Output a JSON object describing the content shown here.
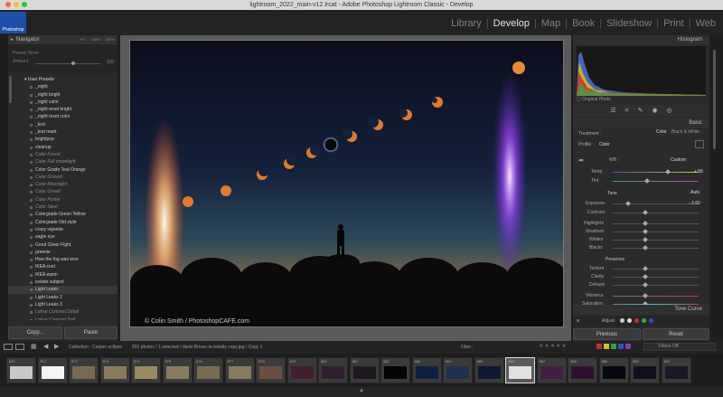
{
  "window": {
    "title": "lightroom_2022_main-v12.lrcat - Adobe Photoshop Lightroom Classic - Develop"
  },
  "logo": {
    "text": "Photoshop"
  },
  "modules": [
    "Library",
    "Develop",
    "Map",
    "Book",
    "Slideshow",
    "Print",
    "Web"
  ],
  "active_module": "Develop",
  "left_panel": {
    "navigator_title": "Navigator",
    "nav_sizes": [
      "FIT",
      "100%",
      "200%"
    ],
    "preset_label": "Preset: None",
    "amount_label": "Amount",
    "amount_value": "100",
    "presets_folder": "User Presets",
    "presets": [
      {
        "label": "_night",
        "italic": false
      },
      {
        "label": "_night bright",
        "italic": false
      },
      {
        "label": "_night color",
        "italic": false
      },
      {
        "label": "_night reset bright",
        "italic": false
      },
      {
        "label": "_night reset color",
        "italic": false
      },
      {
        "label": "_test",
        "italic": false
      },
      {
        "label": "_test reset",
        "italic": false
      },
      {
        "label": "brightpop",
        "italic": false
      },
      {
        "label": "cleanup",
        "italic": false
      },
      {
        "label": "Color Forest",
        "italic": true
      },
      {
        "label": "Color Full moonlight",
        "italic": true
      },
      {
        "label": "Color Grade Teal Orange",
        "italic": false
      },
      {
        "label": "Color Ground",
        "italic": true
      },
      {
        "label": "Color Moonlight",
        "italic": true
      },
      {
        "label": "Color Orwell",
        "italic": true
      },
      {
        "label": "Color Poster",
        "italic": true
      },
      {
        "label": "Color Steel",
        "italic": true
      },
      {
        "label": "Colorgrade Green Yellow",
        "italic": false
      },
      {
        "label": "Colorgrade Old style",
        "italic": false
      },
      {
        "label": "crazy vignette",
        "italic": false
      },
      {
        "label": "eagle eye",
        "italic": false
      },
      {
        "label": "Good Clean Fight",
        "italic": false
      },
      {
        "label": "greenie",
        "italic": false
      },
      {
        "label": "How the fog was won",
        "italic": false
      },
      {
        "label": "IKEA cool",
        "italic": false
      },
      {
        "label": "IKEA warm",
        "italic": false
      },
      {
        "label": "isolate subject",
        "italic": false
      },
      {
        "label": "Light Leaks",
        "italic": false
      },
      {
        "label": "Light Leaks 2",
        "italic": false
      },
      {
        "label": "Light Leaks 3",
        "italic": false
      },
      {
        "label": "Lohse Contrast Detail",
        "italic": true
      },
      {
        "label": "Lohse Contrast Soft",
        "italic": true
      }
    ],
    "copy_button": "Copy...",
    "paste_button": "Paste"
  },
  "photo": {
    "watermark": "© Colin Smith / PhotoshopCAFE.com"
  },
  "right_panel": {
    "histogram_title": "Histogram",
    "original_photo": "Original Photo",
    "basic_title": "Basic",
    "treatment_label": "Treatment :",
    "treatment_options": [
      "Color",
      "Black & White"
    ],
    "profile_label": "Profile :",
    "profile_value": "Color",
    "wb_label": "WB :",
    "wb_value": "Custom",
    "temp_label": "Temp",
    "temp_value": "+ 56",
    "tint_label": "Tint",
    "tint_value": "",
    "tone_label": "Tone",
    "auto_label": "Auto",
    "exposure_label": "Exposure",
    "exposure_value": "- 2.60",
    "contrast_label": "Contrast",
    "highlights_label": "Highlights",
    "shadows_label": "Shadows",
    "whites_label": "Whites",
    "blacks_label": "Blacks",
    "presence_label": "Presence",
    "texture_label": "Texture",
    "clarity_label": "Clarity",
    "dehaze_label": "Dehaze",
    "vibrance_label": "Vibrance",
    "saturation_label": "Saturation",
    "tone_curve_title": "Tone Curve",
    "adjust_label": "Adjust",
    "previous_button": "Previous",
    "reset_button": "Reset"
  },
  "filmstrip_bar": {
    "collection": "Collection : Casper eclipse",
    "selection_info": "891 photos / 1 selected / davis Brown-in-totality copy.jpg / Copy 1",
    "filter_label": "Filter :",
    "filter_value": "Filters Off"
  },
  "thumbnails": [
    "870",
    "871",
    "872",
    "873",
    "874",
    "875",
    "876",
    "877",
    "878",
    "879",
    "880",
    "881",
    "882",
    "883",
    "884",
    "885",
    "886",
    "887",
    "888",
    "889",
    "890",
    "891"
  ]
}
